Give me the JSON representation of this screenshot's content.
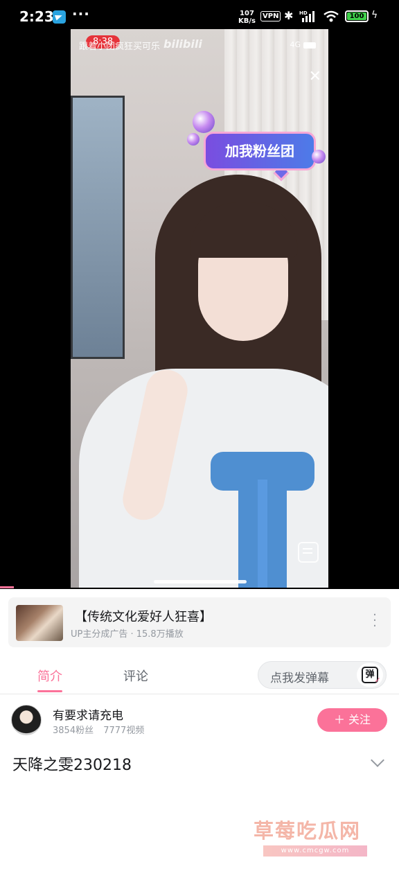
{
  "status_bar": {
    "time": "2:23",
    "more": "···",
    "net_speed_value": "107",
    "net_speed_unit": "KB/s",
    "vpn": "VPN",
    "hd": "HD",
    "battery": "100"
  },
  "video": {
    "rec_time": "8:38",
    "top_text": "跟着小团疯狂买可乐",
    "logo": "bilibili",
    "network": "4G",
    "close_glyph": "✕",
    "fan_badge": "加我粉丝团"
  },
  "ad": {
    "title": "【传统文化爱好人狂喜】",
    "subtitle": "UP主分成广告 · 15.8万播放"
  },
  "tabs": {
    "intro": "简介",
    "comments": "评论",
    "danmaku_placeholder": "点我发弹幕",
    "danmaku_glyph": "弹"
  },
  "uploader": {
    "name": "有要求请充电",
    "fans": "3854粉丝",
    "videos": "7777视频",
    "follow_label": "＋ 关注"
  },
  "video_title": "天降之雯230218",
  "watermark": {
    "text": "草莓吃瓜网",
    "url": "www.cmcgw.com"
  },
  "colors": {
    "accent": "#fb7299",
    "text_primary": "#18191c",
    "text_secondary": "#9499a0"
  }
}
